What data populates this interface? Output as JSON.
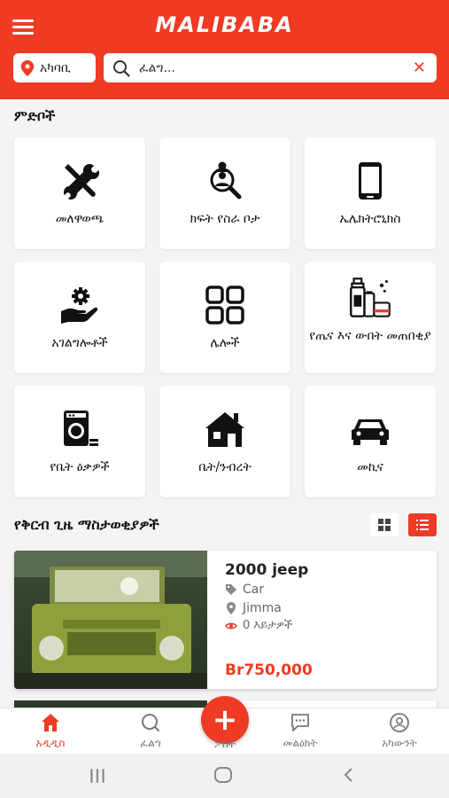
{
  "app": {
    "logo_text": "MALIBABA",
    "brand_color": "#ef3b24"
  },
  "header": {
    "location_label": "አካባቢ",
    "search_placeholder": "ፈልግ..."
  },
  "categories_section": {
    "title": "ምድቦች",
    "items": [
      {
        "label": "መለዋወጫ",
        "icon": "tools-icon"
      },
      {
        "label": "ክፍት የስራ ቦታ",
        "icon": "job-search-icon"
      },
      {
        "label": "ኤሌክትሮኒክስ",
        "icon": "smartphone-icon"
      },
      {
        "label": "አገልግሎቶች",
        "icon": "service-hand-gear-icon"
      },
      {
        "label": "ሌሎች",
        "icon": "grid-icon"
      },
      {
        "label": "የጤና እና ውበት መጠበቂያ",
        "icon": "cosmetics-icon"
      },
      {
        "label": "የቤት ዕቃዎች",
        "icon": "washing-machine-icon"
      },
      {
        "label": "ቤት/ንብረት",
        "icon": "house-icon"
      },
      {
        "label": "መኪና",
        "icon": "car-icon"
      }
    ]
  },
  "recent_section": {
    "title": "የቅርብ ጊዜ ማስታወቂያዎች",
    "listings": [
      {
        "title": "2000 jeep",
        "category": "Car",
        "location": "Jimma",
        "views": "0 እይታዎች",
        "price": "Br750,000"
      }
    ]
  },
  "bottom_nav": {
    "items": [
      {
        "label": "አዲዲስ",
        "icon": "home-icon",
        "active": true
      },
      {
        "label": "ፈልግ",
        "icon": "search-icon",
        "active": false
      },
      {
        "label": "ፖስት",
        "icon": "plus-icon",
        "active": false
      },
      {
        "label": "መልዕክት",
        "icon": "message-icon",
        "active": false
      },
      {
        "label": "አካውንት",
        "icon": "account-icon",
        "active": false
      }
    ]
  }
}
